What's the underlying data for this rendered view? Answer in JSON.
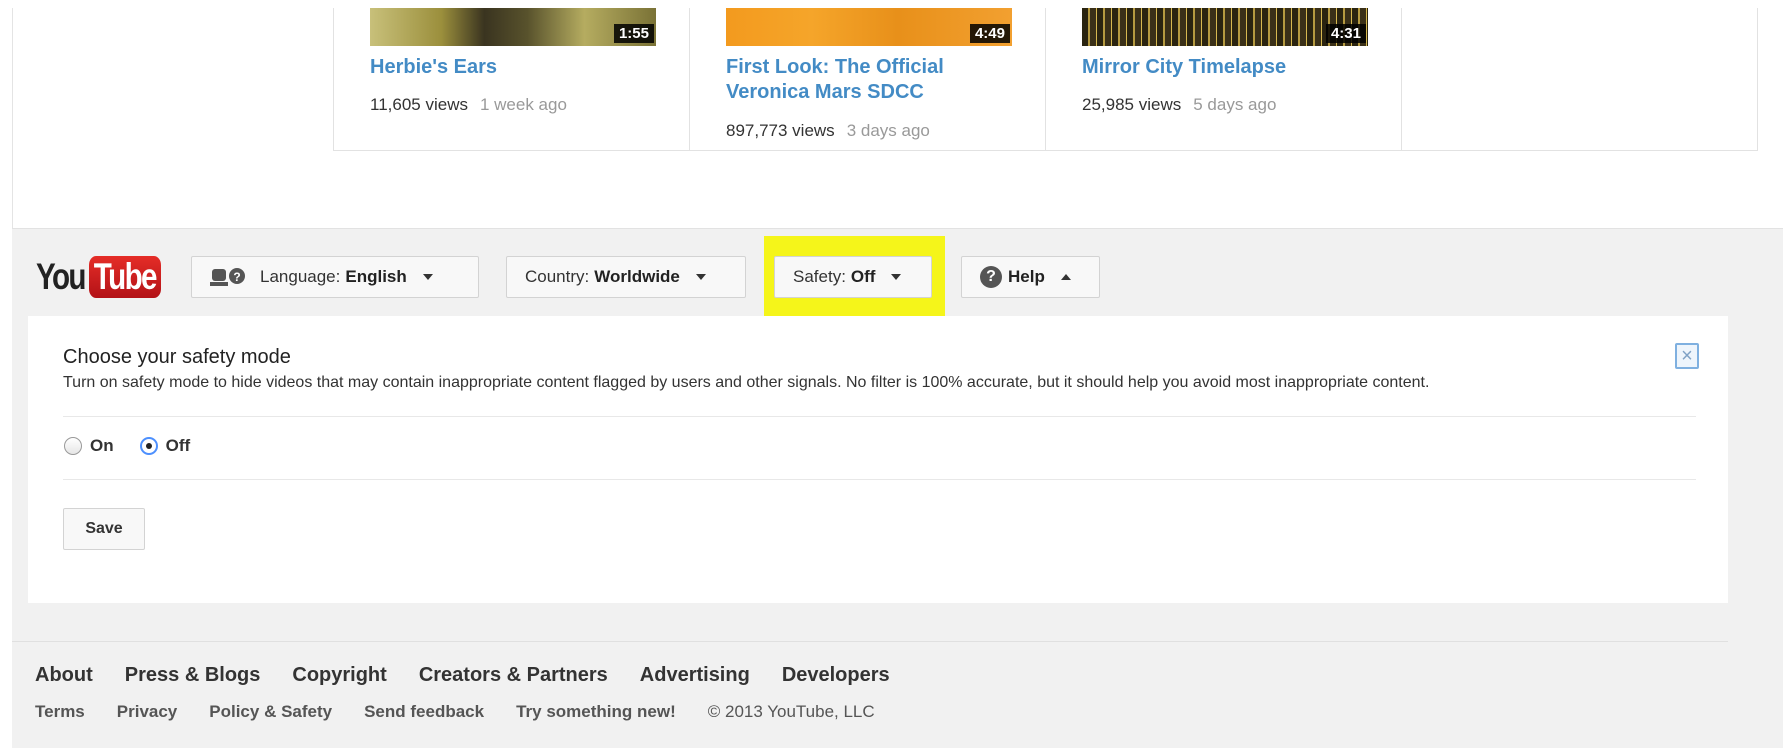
{
  "videos": [
    {
      "title": "Herbie's Ears",
      "duration": "1:55",
      "views": "11,605 views",
      "age": "1 week ago"
    },
    {
      "title": "First Look: The Official Veronica Mars SDCC",
      "duration": "4:49",
      "views": "897,773 views",
      "age": "3 days ago"
    },
    {
      "title": "Mirror City Timelapse",
      "duration": "4:31",
      "views": "25,985 views",
      "age": "5 days ago"
    }
  ],
  "logo": {
    "you": "You",
    "tube": "Tube"
  },
  "pickers": {
    "language_label": "Language:",
    "language_value": "English",
    "country_label": "Country:",
    "country_value": "Worldwide",
    "safety_label": "Safety:",
    "safety_value": "Off",
    "help_label": "Help"
  },
  "safety_panel": {
    "title": "Choose your safety mode",
    "description": "Turn on safety mode to hide videos that may contain inappropriate content flagged by users and other signals. No filter is 100% accurate, but it should help you avoid most inappropriate content.",
    "option_on": "On",
    "option_off": "Off",
    "selected": "Off",
    "save_label": "Save"
  },
  "footer": {
    "primary_links": [
      "About",
      "Press & Blogs",
      "Copyright",
      "Creators & Partners",
      "Advertising",
      "Developers"
    ],
    "secondary_links": [
      "Terms",
      "Privacy",
      "Policy & Safety",
      "Send feedback",
      "Try something new!"
    ],
    "copyright": "© 2013 YouTube, LLC"
  },
  "colors": {
    "link_blue": "#438bc5",
    "highlight_yellow": "#f5f51a",
    "logo_red": "#e52d27"
  }
}
